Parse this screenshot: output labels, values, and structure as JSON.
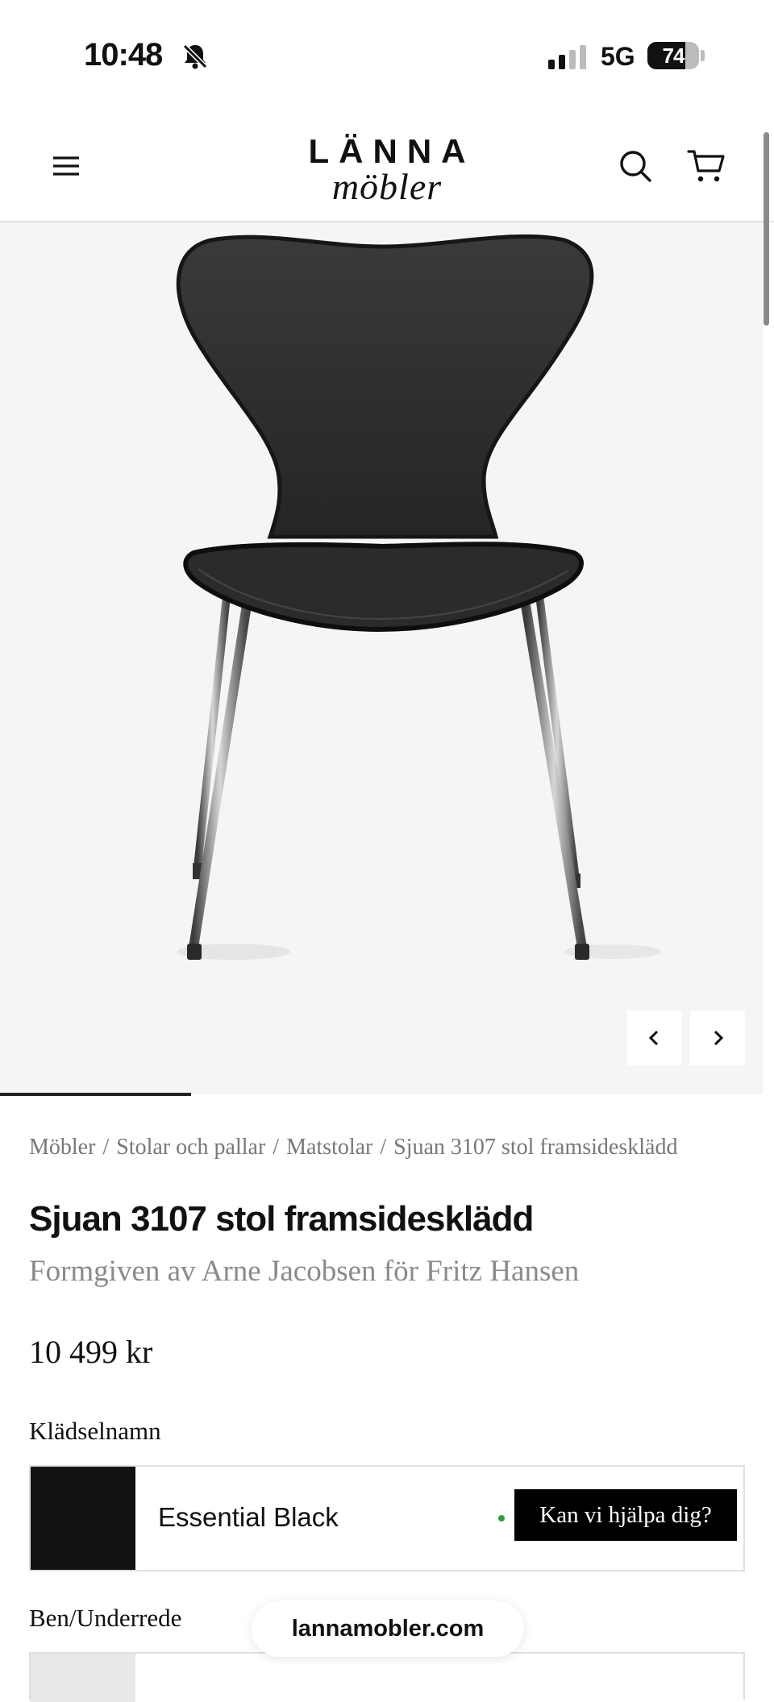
{
  "status_bar": {
    "time": "10:48",
    "network": "5G",
    "battery_percent": "74",
    "battery_level": 0.74
  },
  "header": {
    "logo_line1": "LÄNNA",
    "logo_line2": "möbler",
    "icons": [
      "menu-icon",
      "search-icon",
      "cart-icon"
    ]
  },
  "gallery": {
    "progress_fraction": 0.25
  },
  "breadcrumb": [
    "Möbler",
    "Stolar och pallar",
    "Matstolar",
    "Sjuan 3107 stol framsidesklädd"
  ],
  "product": {
    "title": "Sjuan 3107 stol framsidesklädd",
    "subtitle": "Formgiven av Arne Jacobsen för Fritz Hansen",
    "price": "10 499 kr"
  },
  "options": {
    "upholstery_label": "Klädselnamn",
    "upholstery_value": "Essential Black",
    "base_label": "Ben/Underrede"
  },
  "help_button": "Kan vi hjälpa dig?",
  "url_bar": "lannamobler.com",
  "colors": {
    "accent": "#000000",
    "muted_text": "#777777",
    "stock_green": "#2e9e3a",
    "image_bg": "#f6f5f3"
  }
}
